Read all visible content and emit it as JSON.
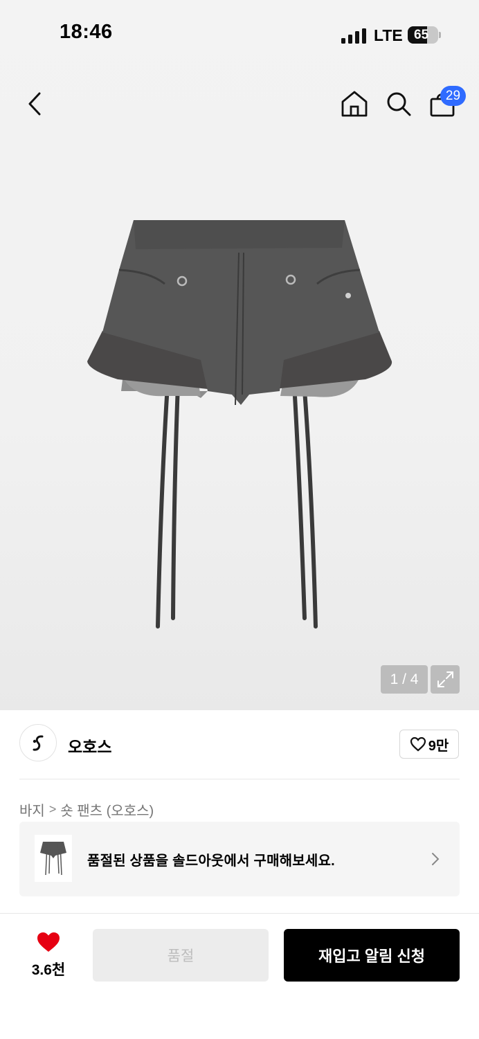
{
  "status_bar": {
    "time": "18:46",
    "network": "LTE",
    "battery": "65"
  },
  "nav": {
    "cart_count": "29"
  },
  "image_pager": {
    "counter": "1 / 4"
  },
  "brand": {
    "name": "오호스",
    "likes": "9만"
  },
  "breadcrumb": {
    "category": "바지",
    "separator": ">",
    "subcategory": "숏 팬츠 (오호스)"
  },
  "soldout_banner": {
    "text": "품절된 상품을 솔드아웃에서 구매해보세요."
  },
  "bottom_bar": {
    "like_count": "3.6천",
    "soldout_label": "품절",
    "restock_label": "재입고 알림 신청"
  },
  "colors": {
    "accent_blue": "#2f6bff",
    "heart_red": "#e60012",
    "primary_black": "#000000"
  }
}
